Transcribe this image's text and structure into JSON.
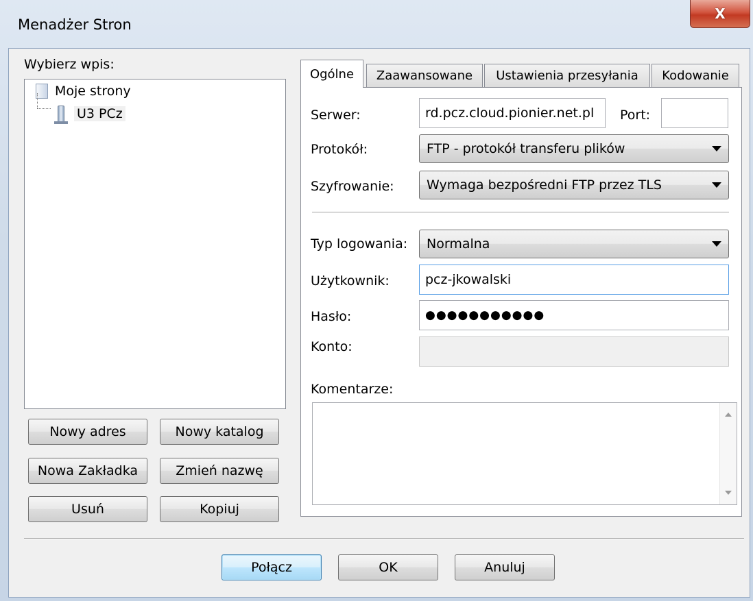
{
  "window": {
    "title": "Menadżer Stron",
    "close_glyph": "X"
  },
  "left": {
    "label": "Wybierz wpis:",
    "tree": {
      "root": {
        "label": "Moje strony",
        "icon": "folder-icon"
      },
      "child": {
        "label": "U3 PCz",
        "icon": "server-icon"
      }
    },
    "buttons": {
      "new_address": "Nowy adres",
      "new_folder": "Nowy katalog",
      "new_bookmark": "Nowa Zakładka",
      "rename": "Zmień nazwę",
      "delete": "Usuń",
      "copy": "Kopiuj"
    }
  },
  "tabs": [
    "Ogólne",
    "Zaawansowane",
    "Ustawienia przesyłania",
    "Kodowanie"
  ],
  "general": {
    "server_label": "Serwer:",
    "server_value": "rd.pcz.cloud.pionier.net.pl",
    "port_label": "Port:",
    "port_value": "",
    "protocol_label": "Protokół:",
    "protocol_value": "FTP - protokół transferu plików",
    "encryption_label": "Szyfrowanie:",
    "encryption_value": "Wymaga bezpośredni FTP przez TLS",
    "logon_label": "Typ logowania:",
    "logon_value": "Normalna",
    "user_label": "Użytkownik:",
    "user_value": "pcz-jkowalski",
    "password_label": "Hasło:",
    "password_value": "●●●●●●●●●●●",
    "account_label": "Konto:",
    "account_value": "",
    "comments_label": "Komentarze:",
    "comments_value": ""
  },
  "footer": {
    "connect": "Połącz",
    "ok": "OK",
    "cancel": "Anuluj"
  }
}
